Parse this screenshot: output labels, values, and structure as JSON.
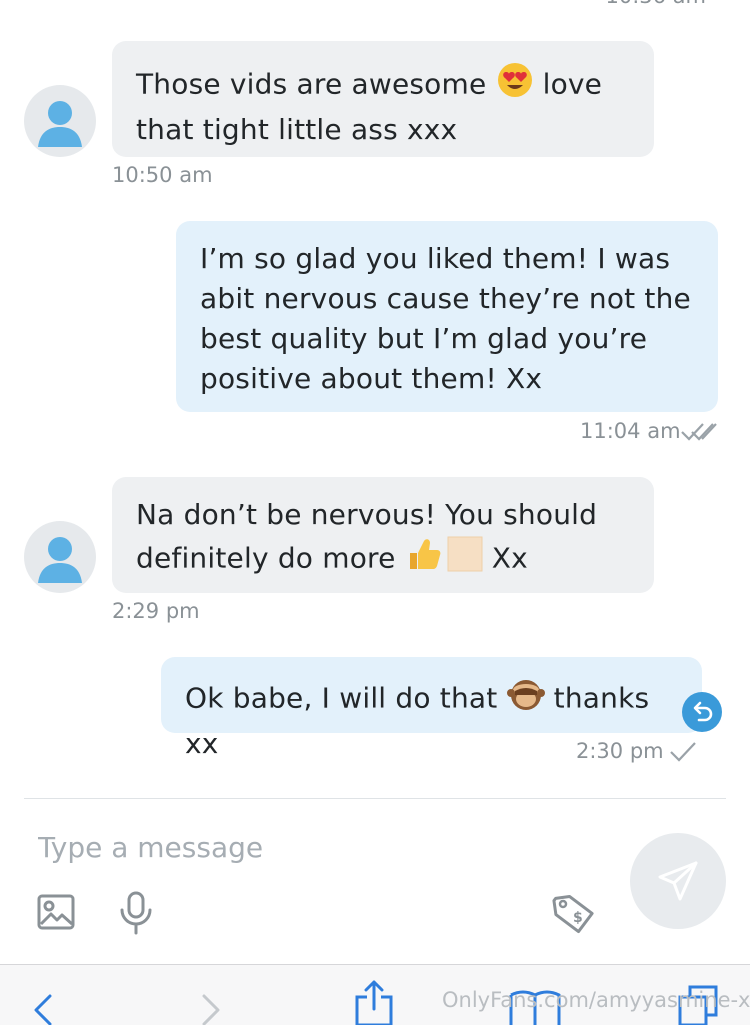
{
  "messages": [
    {
      "direction": "incoming",
      "parts": [
        "Those vids are awesome ",
        " love",
        "that tight little ass xxx"
      ],
      "emoji": [
        "heart-eyes"
      ],
      "time": "10:50 am"
    },
    {
      "direction": "outgoing",
      "lines": [
        "I’m so glad you liked them! I was",
        "abit nervous cause they’re not the",
        "best quality but I’m glad you’re",
        "positive about them! Xx"
      ],
      "time": "11:04 am",
      "status": "read"
    },
    {
      "direction": "incoming",
      "parts": [
        "Na don’t be nervous! You should",
        "definitely do more ",
        " Xx"
      ],
      "emoji": [
        "thumbs-up",
        "skin-tone-modifier"
      ],
      "time": "2:29 pm"
    },
    {
      "direction": "outgoing",
      "parts": [
        "Ok babe, I will do that ",
        " thanks xx"
      ],
      "emoji": [
        "see-no-evil-monkey"
      ],
      "time": "2:30 pm",
      "status": "sent"
    }
  ],
  "composer": {
    "placeholder": "Type a message"
  },
  "icons": {
    "attach_media": "image-icon",
    "voice": "microphone-icon",
    "price_tag": "price-tag-icon",
    "send": "send-icon",
    "undo": "undo-icon"
  },
  "browser": {
    "watermark": "OnlyFans.com/amyyasmine-xx"
  },
  "colors": {
    "incoming_bubble": "#eef0f2",
    "outgoing_bubble": "#e3f1fb",
    "accent": "#3a9ad9",
    "timestamp": "#8a9196"
  }
}
